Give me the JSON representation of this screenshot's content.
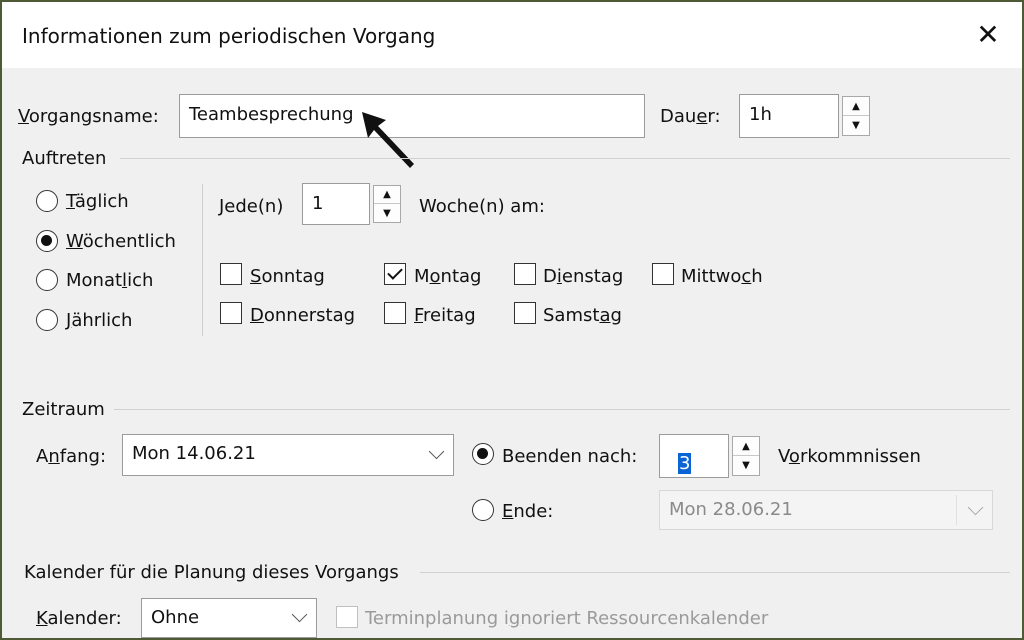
{
  "dialog": {
    "title": "Informationen zum periodischen Vorgang",
    "close_glyph": "✕"
  },
  "task": {
    "name_label": "Vorgangsname:",
    "name_value": "Teambesprechung",
    "duration_label": "Dauer:",
    "duration_value": "1h"
  },
  "recurrence": {
    "section_label": "Auftreten",
    "options": [
      "Täglich",
      "Wöchentlich",
      "Monatlich",
      "Jährlich"
    ],
    "selected": "Wöchentlich",
    "every_label": "Jede(n)",
    "every_value": "1",
    "weeks_on_label": "Woche(n) am:",
    "days": [
      {
        "label": "Sonntag",
        "checked": false
      },
      {
        "label": "Montag",
        "checked": true
      },
      {
        "label": "Dienstag",
        "checked": false
      },
      {
        "label": "Mittwoch",
        "checked": false
      },
      {
        "label": "Donnerstag",
        "checked": false
      },
      {
        "label": "Freitag",
        "checked": false
      },
      {
        "label": "Samstag",
        "checked": false
      }
    ]
  },
  "range": {
    "section_label": "Zeitraum",
    "start_label": "Anfang:",
    "start_value": "Mon 14.06.21",
    "end_after_label": "Beenden nach:",
    "end_after_value": "3",
    "occurrences_label": "Vorkommnissen",
    "end_by_label": "Ende:",
    "end_by_value": "Mon 28.06.21",
    "selected": "end_after"
  },
  "calendar": {
    "section_label": "Kalender für die Planung dieses Vorgangs",
    "calendar_label": "Kalender:",
    "calendar_value": "Ohne",
    "ignore_label": "Terminplanung ignoriert Ressourcenkalender",
    "ignore_checked": false
  },
  "icons": {
    "spin_up": "▲",
    "spin_down": "▼"
  },
  "colors": {
    "frame_border": "#4d5a35",
    "selection_highlight": "#0a64d6"
  }
}
